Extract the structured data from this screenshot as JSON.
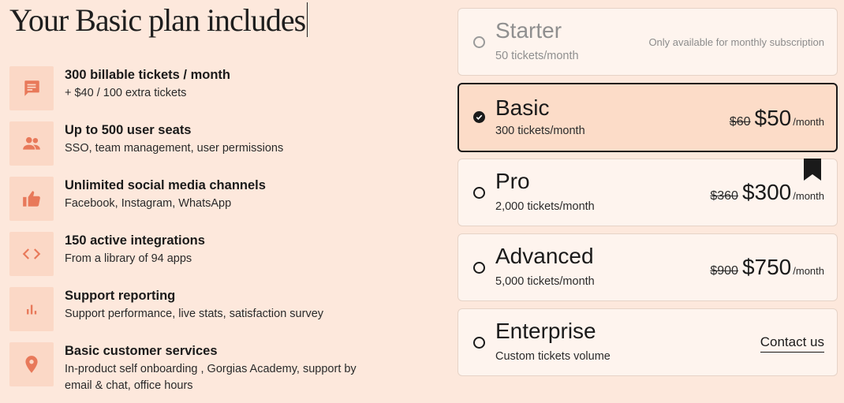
{
  "heading": "Your Basic plan includes",
  "features": [
    {
      "icon": "chat-icon",
      "title": "300 billable tickets / month",
      "desc": "+ $40 / 100 extra tickets"
    },
    {
      "icon": "users-icon",
      "title": "Up to 500 user seats",
      "desc": "SSO, team management, user permissions"
    },
    {
      "icon": "thumbs-up-icon",
      "title": "Unlimited social media channels",
      "desc": "Facebook, Instagram, WhatsApp"
    },
    {
      "icon": "code-icon",
      "title": "150 active integrations",
      "desc": "From a library of 94 apps"
    },
    {
      "icon": "bar-chart-icon",
      "title": "Support reporting",
      "desc": "Support performance, live stats, satisfaction survey"
    },
    {
      "icon": "location-pin-icon",
      "title": "Basic customer services",
      "desc": "In-product self onboarding , Gorgias Academy, support by email & chat, office hours"
    }
  ],
  "plans": [
    {
      "name": "Starter",
      "sub": "50 tickets/month",
      "note": "Only available for monthly subscription"
    },
    {
      "name": "Basic",
      "sub": "300 tickets/month",
      "old_price": "$60",
      "price": "$50",
      "per": "/month"
    },
    {
      "name": "Pro",
      "sub": "2,000 tickets/month",
      "old_price": "$360",
      "price": "$300",
      "per": "/month"
    },
    {
      "name": "Advanced",
      "sub": "5,000 tickets/month",
      "old_price": "$900",
      "price": "$750",
      "per": "/month"
    },
    {
      "name": "Enterprise",
      "sub": "Custom tickets volume",
      "cta": "Contact us"
    }
  ],
  "colors": {
    "background": "#fde8dc",
    "icon_tile": "#fbd8c6",
    "icon_accent": "#e8795a",
    "selected_card": "#fcdcc8",
    "card": "#fef4ee"
  }
}
